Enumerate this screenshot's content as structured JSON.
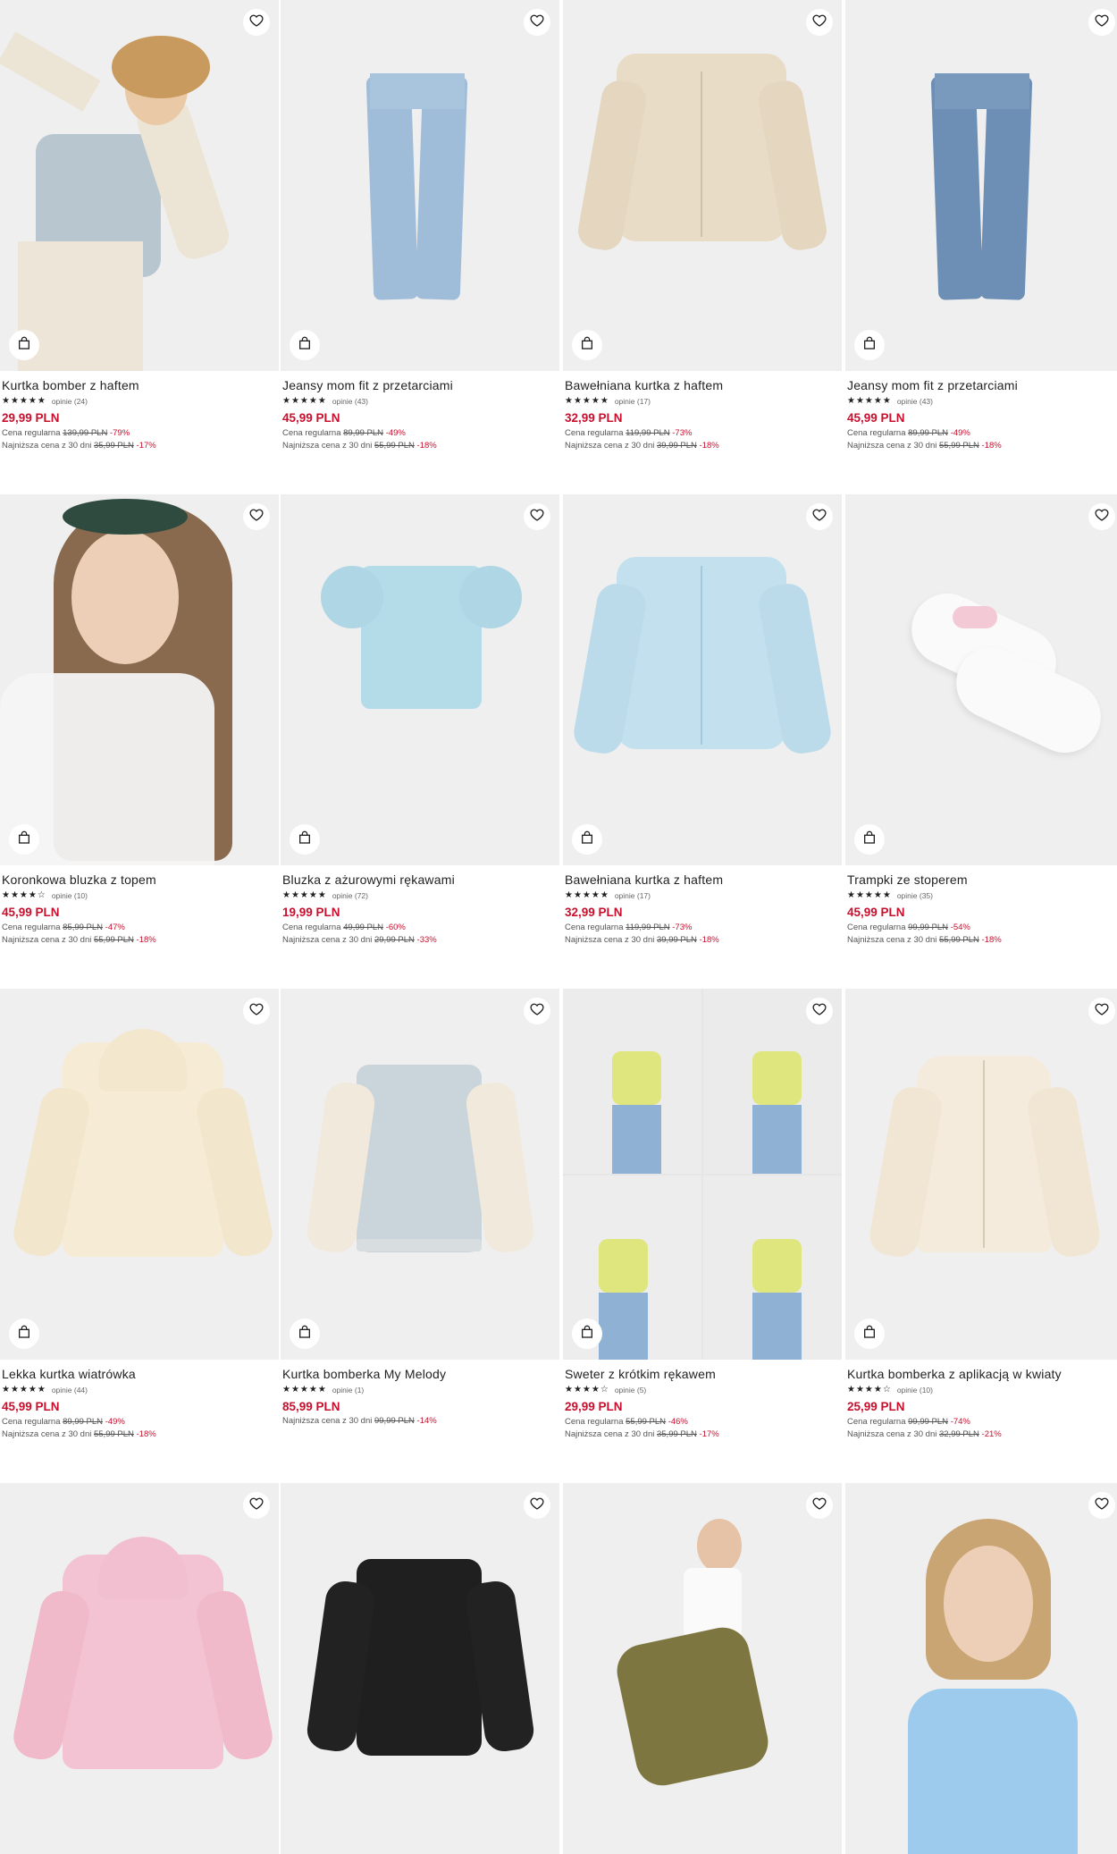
{
  "accent_color": "#c8102e",
  "icons": {
    "wishlist": "heart-icon",
    "add_to_bag": "shopping-bag-icon",
    "rating": "star-icon"
  },
  "products": [
    {
      "name": "Kurtka bomber z haftem",
      "stars": "★★★★★",
      "reviews": "opinie (24)",
      "price": "29,99 PLN",
      "regular_label": "Cena regularna",
      "regular_price": "139,99 PLN",
      "regular_pct": "-79%",
      "lowest_label": "Najniższa cena z 30 dni",
      "lowest_price": "35,99 PLN",
      "lowest_pct": "-17%"
    },
    {
      "name": "Jeansy mom fit z przetarciami",
      "stars": "★★★★★",
      "reviews": "opinie (43)",
      "price": "45,99 PLN",
      "regular_label": "Cena regularna",
      "regular_price": "89,99 PLN",
      "regular_pct": "-49%",
      "lowest_label": "Najniższa cena z 30 dni",
      "lowest_price": "55,99 PLN",
      "lowest_pct": "-18%"
    },
    {
      "name": "Bawełniana kurtka z haftem",
      "stars": "★★★★★",
      "reviews": "opinie (17)",
      "price": "32,99 PLN",
      "regular_label": "Cena regularna",
      "regular_price": "119,99 PLN",
      "regular_pct": "-73%",
      "lowest_label": "Najniższa cena z 30 dni",
      "lowest_price": "39,99 PLN",
      "lowest_pct": "-18%"
    },
    {
      "name": "Jeansy mom fit z przetarciami",
      "stars": "★★★★★",
      "reviews": "opinie (43)",
      "price": "45,99 PLN",
      "regular_label": "Cena regularna",
      "regular_price": "89,99 PLN",
      "regular_pct": "-49%",
      "lowest_label": "Najniższa cena z 30 dni",
      "lowest_price": "55,99 PLN",
      "lowest_pct": "-18%"
    },
    {
      "name": "Koronkowa bluzka z topem",
      "stars": "★★★★☆",
      "reviews": "opinie (10)",
      "price": "45,99 PLN",
      "regular_label": "Cena regularna",
      "regular_price": "85,99 PLN",
      "regular_pct": "-47%",
      "lowest_label": "Najniższa cena z 30 dni",
      "lowest_price": "55,99 PLN",
      "lowest_pct": "-18%"
    },
    {
      "name": "Bluzka z ażurowymi rękawami",
      "stars": "★★★★★",
      "reviews": "opinie (72)",
      "price": "19,99 PLN",
      "regular_label": "Cena regularna",
      "regular_price": "49,99 PLN",
      "regular_pct": "-60%",
      "lowest_label": "Najniższa cena z 30 dni",
      "lowest_price": "29,99 PLN",
      "lowest_pct": "-33%"
    },
    {
      "name": "Bawełniana kurtka z haftem",
      "stars": "★★★★★",
      "reviews": "opinie (17)",
      "price": "32,99 PLN",
      "regular_label": "Cena regularna",
      "regular_price": "119,99 PLN",
      "regular_pct": "-73%",
      "lowest_label": "Najniższa cena z 30 dni",
      "lowest_price": "39,99 PLN",
      "lowest_pct": "-18%"
    },
    {
      "name": "Trampki ze stoperem",
      "stars": "★★★★★",
      "reviews": "opinie (35)",
      "price": "45,99 PLN",
      "regular_label": "Cena regularna",
      "regular_price": "99,99 PLN",
      "regular_pct": "-54%",
      "lowest_label": "Najniższa cena z 30 dni",
      "lowest_price": "55,99 PLN",
      "lowest_pct": "-18%"
    },
    {
      "name": "Lekka kurtka wiatrówka",
      "stars": "★★★★★",
      "reviews": "opinie (44)",
      "price": "45,99 PLN",
      "regular_label": "Cena regularna",
      "regular_price": "89,99 PLN",
      "regular_pct": "-49%",
      "lowest_label": "Najniższa cena z 30 dni",
      "lowest_price": "55,99 PLN",
      "lowest_pct": "-18%"
    },
    {
      "name": "Kurtka bomberka My Melody",
      "stars": "★★★★★",
      "reviews": "opinie (1)",
      "price": "85,99 PLN",
      "regular_label": "",
      "regular_price": "",
      "regular_pct": "",
      "lowest_label": "Najniższa cena z 30 dni",
      "lowest_price": "99,99 PLN",
      "lowest_pct": "-14%"
    },
    {
      "name": "Sweter z krótkim rękawem",
      "stars": "★★★★☆",
      "reviews": "opinie (5)",
      "price": "29,99 PLN",
      "regular_label": "Cena regularna",
      "regular_price": "55,99 PLN",
      "regular_pct": "-46%",
      "lowest_label": "Najniższa cena z 30 dni",
      "lowest_price": "35,99 PLN",
      "lowest_pct": "-17%"
    },
    {
      "name": "Kurtka bomberka z aplikacją w kwiaty",
      "stars": "★★★★☆",
      "reviews": "opinie (10)",
      "price": "25,99 PLN",
      "regular_label": "Cena regularna",
      "regular_price": "99,99 PLN",
      "regular_pct": "-74%",
      "lowest_label": "Najniższa cena z 30 dni",
      "lowest_price": "32,99 PLN",
      "lowest_pct": "-21%"
    },
    {
      "name": "",
      "stars": "",
      "reviews": "",
      "price": "",
      "regular_label": "",
      "regular_price": "",
      "regular_pct": "",
      "lowest_label": "",
      "lowest_price": "",
      "lowest_pct": ""
    },
    {
      "name": "",
      "stars": "",
      "reviews": "",
      "price": "",
      "regular_label": "",
      "regular_price": "",
      "regular_pct": "",
      "lowest_label": "",
      "lowest_price": "",
      "lowest_pct": ""
    },
    {
      "name": "",
      "stars": "",
      "reviews": "",
      "price": "",
      "regular_label": "",
      "regular_price": "",
      "regular_pct": "",
      "lowest_label": "",
      "lowest_price": "",
      "lowest_pct": ""
    },
    {
      "name": "",
      "stars": "",
      "reviews": "",
      "price": "",
      "regular_label": "",
      "regular_price": "",
      "regular_pct": "",
      "lowest_label": "",
      "lowest_price": "",
      "lowest_pct": ""
    }
  ]
}
